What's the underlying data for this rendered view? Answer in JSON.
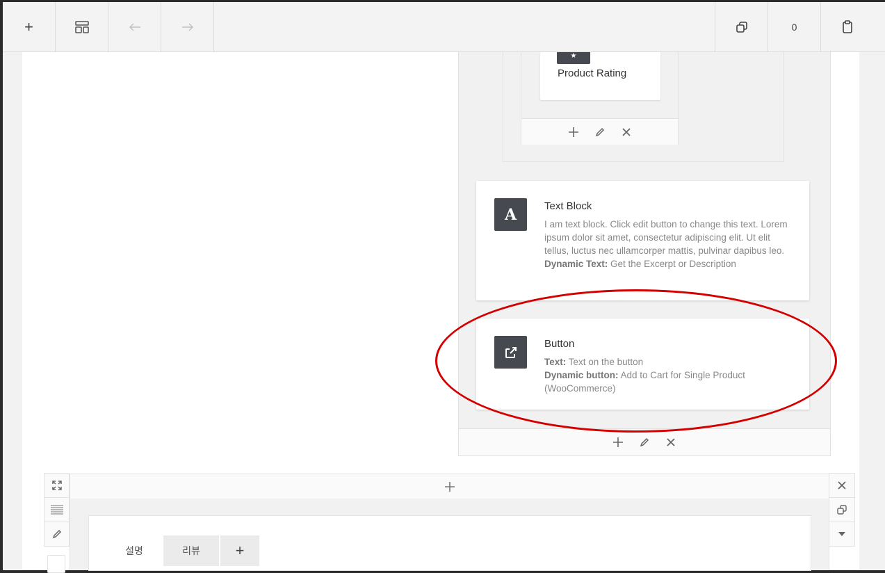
{
  "toolbar": {
    "add_label": "+",
    "undo_count": "0"
  },
  "product_rating": {
    "title": "Product Rating"
  },
  "text_block": {
    "title": "Text Block",
    "icon_letter": "A",
    "description": "I am text block. Click edit button to change this text. Lorem ipsum dolor sit amet, consectetur adipiscing elit. Ut elit tellus, luctus nec ullamcorper mattis, pulvinar dapibus leo.",
    "dynamic_label": "Dynamic Text:",
    "dynamic_value": "Get the Excerpt or Description"
  },
  "button_element": {
    "title": "Button",
    "text_label": "Text:",
    "text_value": "Text on the button",
    "dynamic_label": "Dynamic button:",
    "dynamic_value": "Add to Cart for Single Product (WooCommerce)"
  },
  "tabs": {
    "items": [
      {
        "label": "설명"
      },
      {
        "label": "리뷰"
      },
      {
        "label": "+"
      }
    ]
  },
  "colors": {
    "highlight": "#d40000",
    "element_icon_bg": "#464a50"
  },
  "icons": {
    "add": "plus-icon",
    "templates": "layout-icon",
    "undo": "arrow-left-icon",
    "redo": "arrow-right-icon",
    "clone": "copy-icon",
    "paste": "clipboard-icon",
    "edit": "pencil-icon",
    "delete": "close-icon",
    "fullscreen": "expand-icon",
    "drag": "drag-lines-icon",
    "button": "external-link-icon",
    "collapse": "caret-down-icon"
  }
}
